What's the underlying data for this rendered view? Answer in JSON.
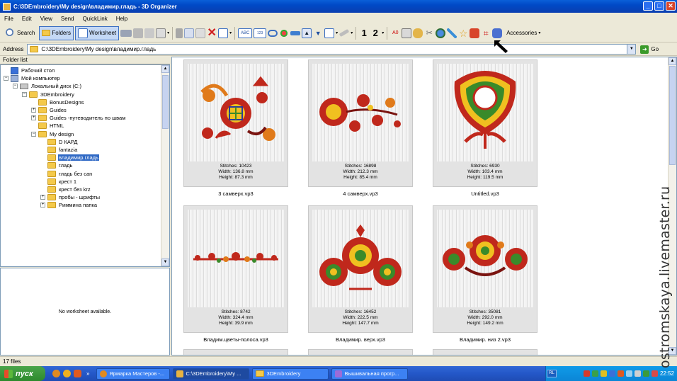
{
  "window": {
    "title": "C:\\3DEmbroidery\\My design\\владимир.гладь - 3D Organizer"
  },
  "menu": [
    "File",
    "Edit",
    "View",
    "Send",
    "QuickLink",
    "Help"
  ],
  "toolbar": {
    "search": "Search",
    "folders": "Folders",
    "worksheet": "Worksheet",
    "accessories": "Accessories"
  },
  "address": {
    "label": "Address",
    "path": "C:\\3DEmbroidery\\My design\\владимир.гладь",
    "go": "Go"
  },
  "folder_list": {
    "header": "Folder list",
    "items": [
      {
        "label": "Рабочий стол",
        "depth": 0,
        "exp": ""
      },
      {
        "label": "Мой компьютер",
        "depth": 0,
        "exp": "−"
      },
      {
        "label": "Локальный диск (C:)",
        "depth": 1,
        "exp": "−"
      },
      {
        "label": "3DEmbroidery",
        "depth": 2,
        "exp": "−"
      },
      {
        "label": "BonusDesigns",
        "depth": 3,
        "exp": ""
      },
      {
        "label": "Guides",
        "depth": 3,
        "exp": "+"
      },
      {
        "label": "Guides -путеводитель по швам",
        "depth": 3,
        "exp": "+"
      },
      {
        "label": "HTML",
        "depth": 3,
        "exp": ""
      },
      {
        "label": "My design",
        "depth": 3,
        "exp": "−"
      },
      {
        "label": "D КАРД",
        "depth": 4,
        "exp": ""
      },
      {
        "label": "fantazia",
        "depth": 4,
        "exp": ""
      },
      {
        "label": "владимир.гладь",
        "depth": 4,
        "exp": "",
        "selected": true
      },
      {
        "label": "гладь",
        "depth": 4,
        "exp": ""
      },
      {
        "label": "гладь без can",
        "depth": 4,
        "exp": ""
      },
      {
        "label": "крест 1",
        "depth": 4,
        "exp": ""
      },
      {
        "label": "крест без krz",
        "depth": 4,
        "exp": ""
      },
      {
        "label": "пробы - шрифты",
        "depth": 4,
        "exp": "+"
      },
      {
        "label": "Риммина папка",
        "depth": 4,
        "exp": "+"
      }
    ]
  },
  "worksheet_pane": {
    "text": "No worksheet available."
  },
  "designs": [
    {
      "stitches": "Stitches: 10423",
      "width": "Width: 136.8 mm",
      "height": "Height: 87.3 mm",
      "name": "3 самверх.vp3",
      "motif": "flower-scroll"
    },
    {
      "stitches": "Stitches: 16898",
      "width": "Width: 212.3 mm",
      "height": "Height: 85.4 mm",
      "name": "4 самверх.vp3",
      "motif": "flower-branch"
    },
    {
      "stitches": "Stitches: 6930",
      "width": "Width: 103.4 mm",
      "height": "Height: 119.5 mm",
      "name": "Untitled.vp3",
      "motif": "tulip"
    },
    {
      "stitches": "Stitches: 8742",
      "width": "Width: 324.4 mm",
      "height": "Height: 39.9 mm",
      "name": "Владим.цветы-полоса.vp3",
      "motif": "border"
    },
    {
      "stitches": "Stitches: 16452",
      "width": "Width: 222.5 mm",
      "height": "Height: 147.7 mm",
      "name": "Владимир. верх.vp3",
      "motif": "bouquet-top"
    },
    {
      "stitches": "Stitches: 35081",
      "width": "Width: 292.0 mm",
      "height": "Height: 149.2 mm",
      "name": "Владимир. низ 2.vp3",
      "motif": "bouquet-low"
    }
  ],
  "status": {
    "files": "17 files"
  },
  "taskbar": {
    "start": "пуск",
    "tasks": [
      "Ярмарка Мастеров -...",
      "C:\\3DEmbroidery\\My ...",
      "3DEmbroidery",
      "Вышивальная прогр..."
    ],
    "lang": "RL",
    "clock": "22:52"
  },
  "watermark": "ostromskaya.livemaster.ru",
  "colors": {
    "titlebar": "#0a5fd8",
    "selection": "#316ac5",
    "taskbar": "#2457c8",
    "start": "#3a9a3a",
    "embroidery_red": "#c0281c"
  }
}
